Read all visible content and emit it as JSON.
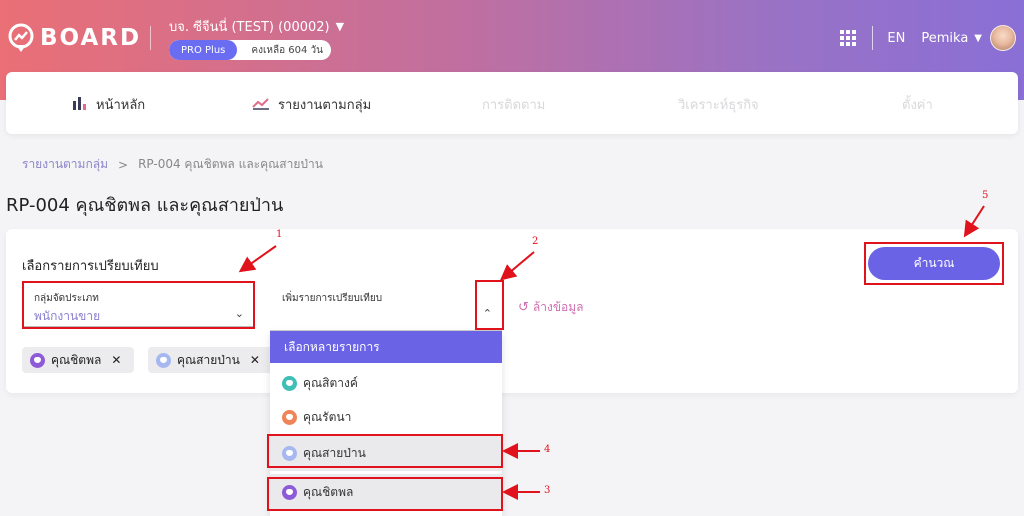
{
  "header": {
    "logo_text": "BOARD",
    "company": "บจ. ซีจีนนี่ (TEST) (00002)",
    "plan_tag": "PRO Plus",
    "plan_remaining": "คงเหลือ 604 วัน",
    "lang": "EN",
    "user_name": "Pemika"
  },
  "nav": {
    "items": [
      {
        "label": "หน้าหลัก",
        "icon": "bar-chart-icon"
      },
      {
        "label": "รายงานตามกลุ่ม",
        "icon": "trend-line-icon"
      },
      {
        "label": "การติดตาม"
      },
      {
        "label": "วิเคราะห์ธุรกิจ"
      },
      {
        "label": "ตั้งค่า"
      }
    ]
  },
  "breadcrumb": {
    "parent": "รายงานตามกลุ่ม",
    "separator": ">",
    "current": "RP-004 คุณชิตพล และคุณสายป่าน"
  },
  "page": {
    "title": "RP-004 คุณชิตพล และคุณสายป่าน",
    "section_label": "เลือกรายการเปรียบเทียบ",
    "group_select": {
      "label": "กลุ่มจัดประเภท",
      "value": "พนักงานขาย"
    },
    "compare_select": {
      "label": "เพิ่มรายการเปรียบเทียบ"
    },
    "clear_label": "ล้างข้อมูล",
    "calc_label": "คำนวณ",
    "chips": [
      {
        "label": "คุณชิตพล",
        "color": "#8e5bd8"
      },
      {
        "label": "คุณสายป่าน",
        "color": "#a7b8f0"
      }
    ]
  },
  "dropdown": {
    "header": "เลือกหลายรายการ",
    "items": [
      {
        "label": "คุณสิตางค์",
        "color": "#3fbfb6"
      },
      {
        "label": "คุณรัตนา",
        "color": "#ef8458"
      },
      {
        "label": "คุณสายป่าน",
        "color": "#a7b8f0"
      },
      {
        "label": "คุณชิตพล",
        "color": "#8e5bd8"
      }
    ]
  },
  "annotations": {
    "n1": "1",
    "n2": "2",
    "n3": "3",
    "n4": "4",
    "n5": "5"
  },
  "colors": {
    "accent": "#6a63e6",
    "annotation": "#e0121b",
    "link": "#8a84c8",
    "clear": "#d06fb0"
  }
}
